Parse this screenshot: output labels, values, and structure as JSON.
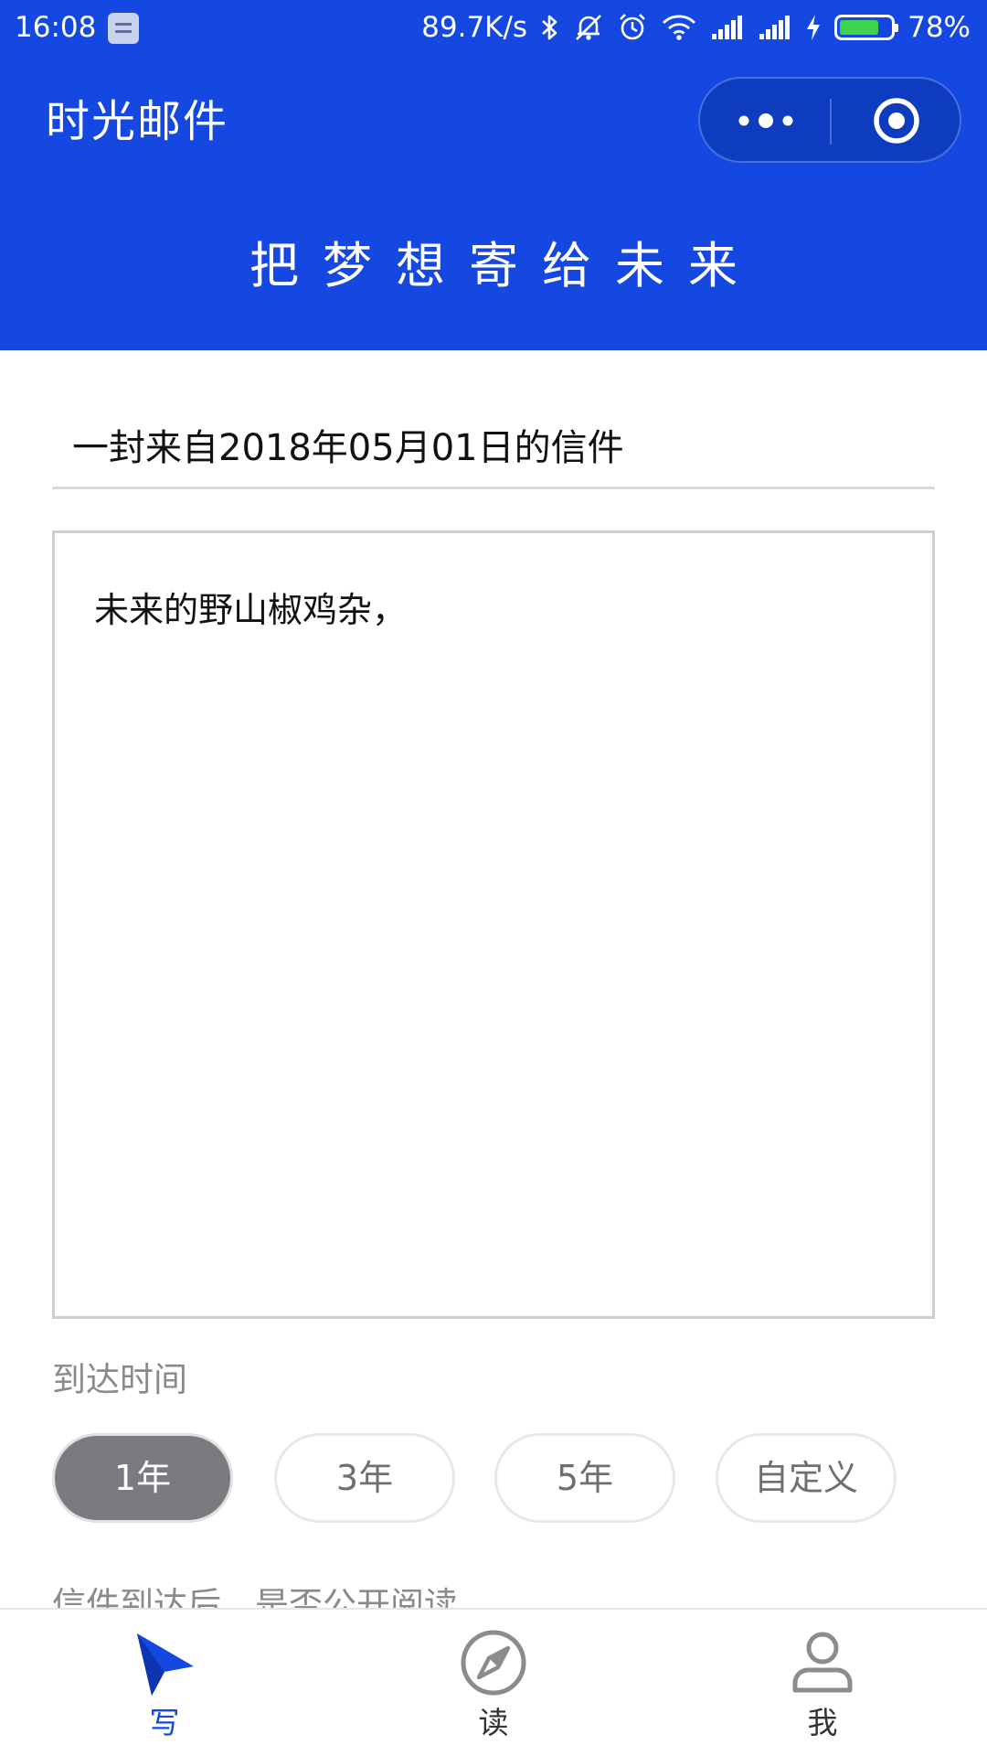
{
  "status_bar": {
    "time": "16:08",
    "net_speed": "89.7K/s",
    "battery_percent": "78%",
    "battery_level": 0.78
  },
  "header": {
    "title": "时光邮件",
    "slogan": "把梦想寄给未来"
  },
  "letter": {
    "subject": "一封来自2018年05月01日的信件",
    "body": "未来的野山椒鸡杂，"
  },
  "arrival": {
    "label": "到达时间",
    "options": [
      {
        "label": "1年",
        "selected": true
      },
      {
        "label": "3年",
        "selected": false
      },
      {
        "label": "5年",
        "selected": false
      },
      {
        "label": "自定义",
        "selected": false
      }
    ]
  },
  "public_read": {
    "label": "信件到达后，是否公开阅读"
  },
  "tabs": [
    {
      "label": "写",
      "icon": "paper-plane-icon",
      "active": true
    },
    {
      "label": "读",
      "icon": "compass-icon",
      "active": false
    },
    {
      "label": "我",
      "icon": "person-icon",
      "active": false
    }
  ],
  "colors": {
    "brand_blue": "#1448e0",
    "selected_option": "#7a7b80",
    "battery_green": "#3fd24d"
  }
}
